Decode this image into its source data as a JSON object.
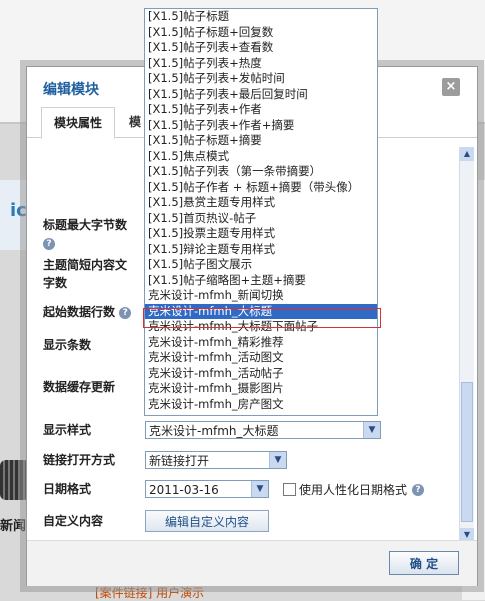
{
  "background": {
    "logo_fragment": "ic",
    "news_fragment": "新闻",
    "bottom_fragment": "[案件链接] 用户演示"
  },
  "modal": {
    "title": "编辑模块",
    "close_label": "×",
    "tabs": [
      {
        "label": "模块属性",
        "active": true
      },
      {
        "label": "模",
        "active": false
      }
    ],
    "fields": {
      "title_max_bytes": "标题最大字节数",
      "summary_length": "主题简短内容文",
      "summary_length_2": "字数",
      "start_row": "起始数据行数",
      "show_count": "显示条数",
      "cache_update": "数据缓存更新",
      "display_style": "显示样式",
      "display_style_value": "克米设计-mfmh_大标题",
      "link_open_mode": "链接打开方式",
      "link_open_value": "新链接打开",
      "date_format": "日期格式",
      "date_format_value": "2011-03-16",
      "humanized_date": "使用人性化日期格式",
      "custom_content": "自定义内容",
      "edit_custom_button": "编辑自定义内容"
    },
    "help_icon_glyph": "?",
    "confirm_button": "确 定"
  },
  "dropdown": {
    "selected_index": 19,
    "options": [
      "[X1.5]帖子标题",
      "[X1.5]帖子标题+回复数",
      "[X1.5]帖子列表+查看数",
      "[X1.5]帖子列表+热度",
      "[X1.5]帖子列表+发帖时间",
      "[X1.5]帖子列表+最后回复时间",
      "[X1.5]帖子列表+作者",
      "[X1.5]帖子列表+作者+摘要",
      "[X1.5]帖子标题+摘要",
      "[X1.5]焦点模式",
      "[X1.5]帖子列表（第一条带摘要）",
      "[X1.5]帖子作者 + 标题+摘要（带头像）",
      "[X1.5]悬赏主题专用样式",
      "[X1.5]首页热议-帖子",
      "[X1.5]投票主题专用样式",
      "[X1.5]辩论主题专用样式",
      "[X1.5]帖子图文展示",
      "[X1.5]帖子缩略图+主题+摘要",
      "克米设计-mfmh_新闻切换",
      "克米设计-mfmh_大标题",
      "克米设计-mfmh_大标题下面帖子",
      "克米设计-mfmh_精彩推荐",
      "克米设计-mfmh_活动图文",
      "克米设计-mfmh_活动帖子",
      "克米设计-mfmh_摄影图片",
      "克米设计-mfmh_房产图文"
    ]
  }
}
